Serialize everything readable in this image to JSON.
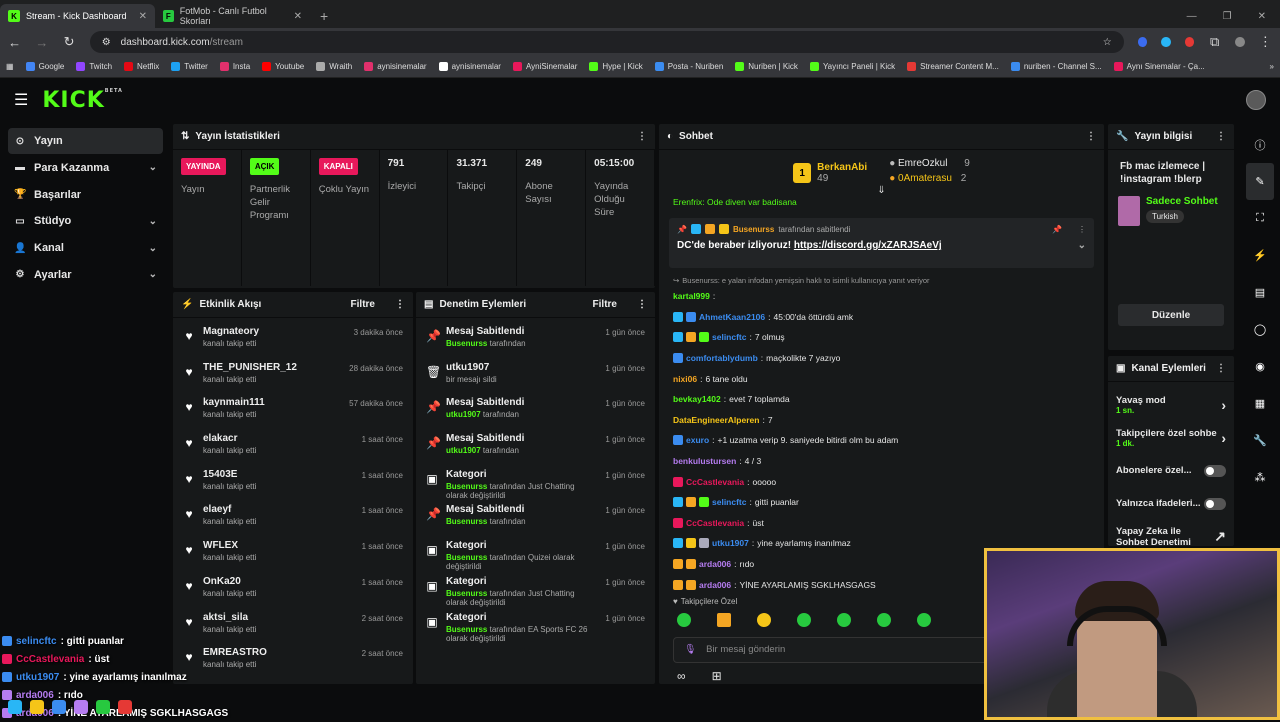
{
  "browser": {
    "tabs": [
      {
        "label": "Stream - Kick Dashboard",
        "active": true
      },
      {
        "label": "FotMob - Canlı Futbol Skorları",
        "active": false
      }
    ],
    "url_host": "dashboard.kick.com",
    "url_path": "/stream",
    "bookmarks": [
      "Google",
      "Twitch",
      "Netflix",
      "Twitter",
      "Insta",
      "Youtube",
      "Wraith",
      "aynisinemalar",
      "aynisinemalar",
      "AyniSinemalar",
      "Hype | Kick",
      "Posta - Nuriben",
      "Nuriben | Kick",
      "Yayıncı Paneli | Kick",
      "Streamer Content M...",
      "nuriben - Channel S...",
      "Aynı Sinemalar - Ça..."
    ]
  },
  "logo": "KICK",
  "logo_beta": "BETA",
  "sidebar": {
    "items": [
      {
        "label": "Yayın",
        "icon": "broadcast-icon",
        "active": true,
        "chev": false
      },
      {
        "label": "Para Kazanma",
        "icon": "money-icon",
        "chev": true
      },
      {
        "label": "Başarılar",
        "icon": "trophy-icon",
        "chev": false
      },
      {
        "label": "Stüdyo",
        "icon": "studio-icon",
        "chev": true
      },
      {
        "label": "Kanal",
        "icon": "user-icon",
        "chev": true
      },
      {
        "label": "Ayarlar",
        "icon": "gear-icon",
        "chev": true
      }
    ]
  },
  "stats": {
    "title": "Yayın İstatistikleri",
    "cols": [
      {
        "badge": "YAYINDA",
        "badge_color": "#e8185b",
        "label": "Yayın"
      },
      {
        "badge": "AÇIK",
        "badge_color": "#53fc18",
        "label": "Partnerlik Gelir Programı"
      },
      {
        "badge": "KAPALI",
        "badge_color": "#e8185b",
        "label": "Çoklu Yayın"
      },
      {
        "value": "791",
        "label": "İzleyici"
      },
      {
        "value": "31.371",
        "label": "Takipçi"
      },
      {
        "value": "249",
        "label": "Abone Sayısı"
      },
      {
        "value": "05:15:00",
        "label": "Yayında Olduğu Süre"
      }
    ]
  },
  "activity": {
    "title": "Etkinlik Akışı",
    "filter": "Filtre",
    "items": [
      {
        "name": "Magnateory",
        "sub": "kanalı takip etti",
        "time": "3 dakika önce"
      },
      {
        "name": "THE_PUNISHER_12",
        "sub": "kanalı takip etti",
        "time": "28 dakika önce"
      },
      {
        "name": "kaynmain111",
        "sub": "kanalı takip etti",
        "time": "57 dakika önce"
      },
      {
        "name": "elakacr",
        "sub": "kanalı takip etti",
        "time": "1 saat önce"
      },
      {
        "name": "15403E",
        "sub": "kanalı takip etti",
        "time": "1 saat önce"
      },
      {
        "name": "elaeyf",
        "sub": "kanalı takip etti",
        "time": "1 saat önce"
      },
      {
        "name": "WFLEX",
        "sub": "kanalı takip etti",
        "time": "1 saat önce"
      },
      {
        "name": "OnKa20",
        "sub": "kanalı takip etti",
        "time": "1 saat önce"
      },
      {
        "name": "aktsi_sila",
        "sub": "kanalı takip etti",
        "time": "2 saat önce"
      },
      {
        "name": "EMREASTRO",
        "sub": "kanalı takip etti",
        "time": "2 saat önce"
      }
    ]
  },
  "moderation": {
    "title": "Denetim Eylemleri",
    "filter": "Filtre",
    "items": [
      {
        "icon": "pin-icon",
        "title": "Mesaj Sabitlendi",
        "user": "Busenurss",
        "rest": "tarafından",
        "time": "1 gün önce"
      },
      {
        "icon": "trash-icon",
        "title": "utku1907",
        "user": "",
        "rest": "bir mesajı sildi",
        "time": "1 gün önce"
      },
      {
        "icon": "pin-icon",
        "title": "Mesaj Sabitlendi",
        "user": "utku1907",
        "rest": "tarafından",
        "time": "1 gün önce"
      },
      {
        "icon": "pin-icon",
        "title": "Mesaj Sabitlendi",
        "user": "utku1907",
        "rest": "tarafından",
        "time": "1 gün önce"
      },
      {
        "icon": "category-icon",
        "title": "Kategori",
        "user": "Busenurss",
        "rest": "tarafından Just Chatting olarak değiştirildi",
        "time": "1 gün önce"
      },
      {
        "icon": "pin-icon",
        "title": "Mesaj Sabitlendi",
        "user": "Busenurss",
        "rest": "tarafından",
        "time": "1 gün önce"
      },
      {
        "icon": "category-icon",
        "title": "Kategori",
        "user": "Busenurss",
        "rest": "tarafından Quizei olarak değiştirildi",
        "time": "1 gün önce"
      },
      {
        "icon": "category-icon",
        "title": "Kategori",
        "user": "Busenurss",
        "rest": "tarafından Just Chatting olarak değiştirildi",
        "time": "1 gün önce"
      },
      {
        "icon": "category-icon",
        "title": "Kategori",
        "user": "Busenurss",
        "rest": "tarafından EA Sports FC 26 olarak değiştirildi",
        "time": "1 gün önce"
      }
    ]
  },
  "chat": {
    "title": "Sohbet",
    "leaderboard": [
      {
        "rank": "1",
        "name": "BerkanAbi",
        "count": "49"
      },
      {
        "name": "EmreOzkul",
        "count": "9"
      },
      {
        "name": "0Amaterasu",
        "count": "2"
      }
    ],
    "partial": "Erenfrix: Ode diven var badisana",
    "pinned": {
      "by": "Busenurss",
      "suffix": "tarafından sabitlendi",
      "msg": "DC'de beraber izliyoruz!",
      "link": "https://discord.gg/xZARJSAeVj"
    },
    "reply": "Busenurss: e yalan infodan yemişsin haklı to isimli kullanıcıya yanıt veriyor",
    "messages": [
      {
        "user": "kartal999",
        "color": "#53fc18",
        "text": "",
        "badges": []
      },
      {
        "user": "AhmetKaan2106",
        "color": "#3b8cf0",
        "text": "45:00'da öttürdü amk",
        "badges": [
          "#29b6f6",
          "#3b8cf0"
        ]
      },
      {
        "user": "selincftc",
        "color": "#3b8cf0",
        "text": "7 olmuş",
        "badges": [
          "#29b6f6",
          "#f5a623",
          "#53fc18"
        ]
      },
      {
        "user": "comfortablydumb",
        "color": "#3b8cf0",
        "text": "maçkolikte 7 yazıyo",
        "badges": [
          "#3b8cf0"
        ]
      },
      {
        "user": "nixi06",
        "color": "#f5a623",
        "text": "6 tane oldu",
        "badges": []
      },
      {
        "user": "bevkay1402",
        "color": "#53fc18",
        "text": "evet 7 toplamda",
        "badges": []
      },
      {
        "user": "DataEngineerAlperen",
        "color": "#f5c518",
        "text": "7",
        "badges": []
      },
      {
        "user": "exuro",
        "color": "#3b8cf0",
        "text": "+1 uzatma verip 9. saniyede bitirdi olm bu adam",
        "badges": [
          "#3b8cf0"
        ]
      },
      {
        "user": "benkulustursen",
        "color": "#b57cf0",
        "text": "4 / 3",
        "badges": []
      },
      {
        "user": "CcCastlevania",
        "color": "#e8185b",
        "text": "ooooo",
        "badges": [
          "#e8185b"
        ]
      },
      {
        "user": "selincftc",
        "color": "#3b8cf0",
        "text": "gitti puanlar",
        "badges": [
          "#29b6f6",
          "#f5a623",
          "#53fc18"
        ]
      },
      {
        "user": "CcCastlevania",
        "color": "#e8185b",
        "text": "üst",
        "badges": [
          "#e8185b"
        ]
      },
      {
        "user": "utku1907",
        "color": "#3b8cf0",
        "text": "yine ayarlamış inanılmaz",
        "badges": [
          "#29b6f6",
          "#f5c518",
          "#aab"
        ]
      },
      {
        "user": "arda006",
        "color": "#b57cf0",
        "text": "rıdo",
        "badges": [
          "#f5a623",
          "#f5a623"
        ]
      },
      {
        "user": "arda006",
        "color": "#b57cf0",
        "text": "YİNE AYARLAMIŞ SGKLHASGAGS",
        "badges": [
          "#f5a623",
          "#f5a623"
        ]
      }
    ],
    "followers_only": "Takipçilere Özel",
    "input_placeholder": "Bir mesaj gönderin"
  },
  "info": {
    "title": "Yayın bilgisi",
    "stream_title": "Fb mac izlemece | !instagram !blerp",
    "category": "Sadece Sohbet",
    "tag": "Turkish",
    "edit": "Düzenle"
  },
  "channel_actions": {
    "title": "Kanal Eylemleri",
    "items": [
      {
        "label": "Yavaş mod",
        "sub": "1 sn.",
        "kind": "chev"
      },
      {
        "label": "Takipçilere özel sohbe",
        "sub": "1 dk.",
        "kind": "chev"
      },
      {
        "label": "Abonelere özel...",
        "kind": "toggle"
      },
      {
        "label": "Yalnızca ifadeleri...",
        "kind": "toggle"
      },
      {
        "label": "Yapay Zeka ile Sohbet Denetimi",
        "kind": "link"
      }
    ]
  },
  "overlay": [
    {
      "user": "selincftc",
      "color": "#3b8cf0",
      "text": ": gitti puanlar"
    },
    {
      "user": "CcCastlevania",
      "color": "#e8185b",
      "text": ": üst"
    },
    {
      "user": "utku1907",
      "color": "#3b8cf0",
      "text": ": yine ayarlamış inanılmaz"
    },
    {
      "user": "arda006",
      "color": "#b57cf0",
      "text": ": rıdo"
    },
    {
      "user": "arda006",
      "color": "#b57cf0",
      "text": ": YİNE AYARLAMIŞ SGKLHASGAGS"
    }
  ],
  "colors": {
    "accent": "#53fc18",
    "danger": "#e8185b",
    "panel": "#17191a"
  }
}
